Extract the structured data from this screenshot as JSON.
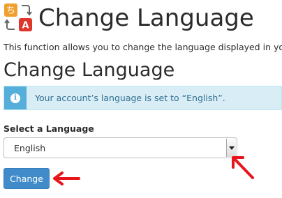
{
  "header": {
    "title": "Change Language",
    "icon": "language-icon",
    "icon_glyph_top": "ち",
    "icon_glyph_bottom": "A"
  },
  "description": "This function allows you to change the language displayed in your cPanel interface.",
  "section": {
    "title": "Change Language"
  },
  "alert": {
    "icon": "info-icon",
    "icon_glyph": "i",
    "text": "Your account’s language is set to “English”."
  },
  "form": {
    "select_label": "Select a Language",
    "selected_language": "English",
    "submit_label": "Change"
  },
  "colors": {
    "primary": "#428bca",
    "info_bg": "#d9edf7",
    "info_icon_bg": "#56aedb",
    "annotation_arrow": "#e8141b"
  }
}
